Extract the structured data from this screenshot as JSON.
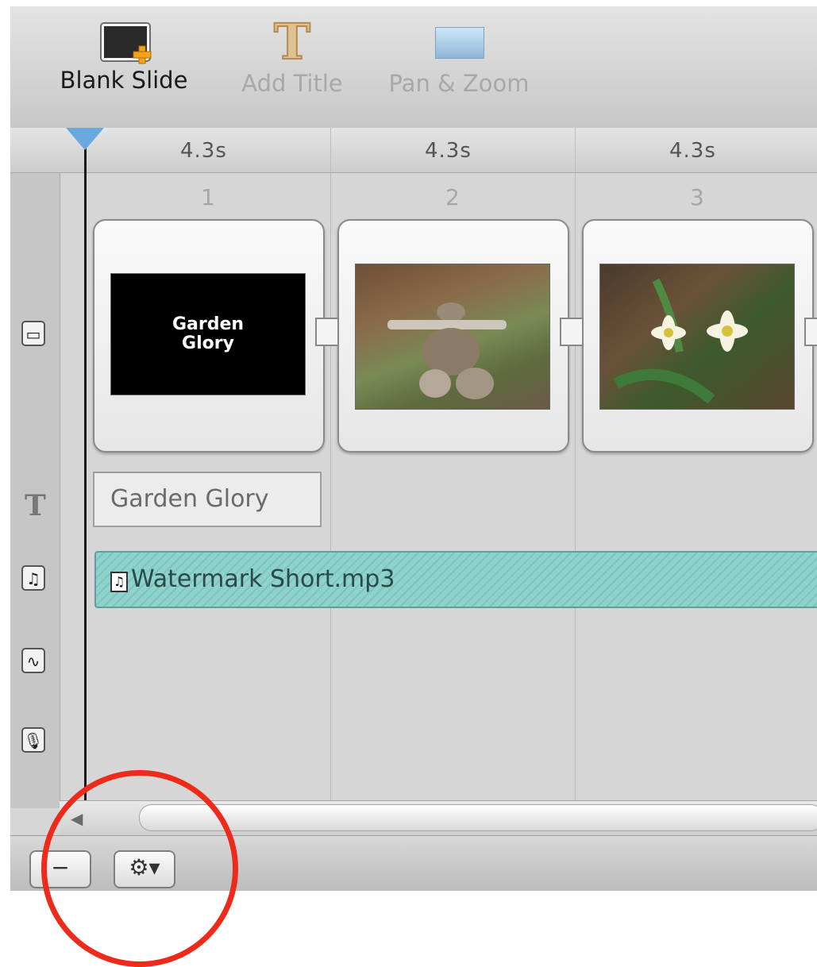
{
  "toolbar": {
    "blank_slide": "Blank Slide",
    "add_title": "Add Title",
    "pan_zoom": "Pan & Zoom"
  },
  "ruler": {
    "durations": [
      "4.3s",
      "4.3s",
      "4.3s"
    ]
  },
  "slides": [
    {
      "number": "1",
      "title_line1": "Garden",
      "title_line2": "Glory"
    },
    {
      "number": "2"
    },
    {
      "number": "3"
    }
  ],
  "title_track": {
    "text": "Garden Glory"
  },
  "audio_track": {
    "filename": "Watermark Short.mp3"
  },
  "colors": {
    "audio_fill": "#8fd1cb",
    "playhead": "#6aa8e0",
    "annotation": "#ee2a1a"
  }
}
